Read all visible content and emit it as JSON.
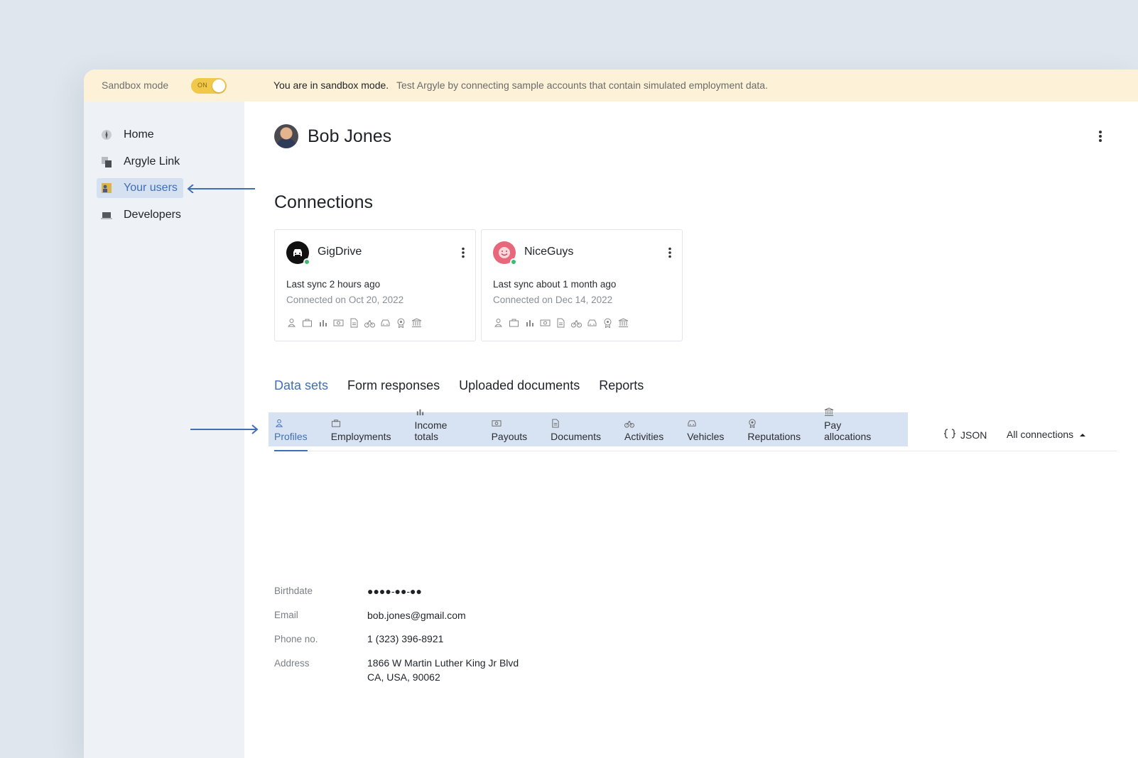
{
  "banner": {
    "sandbox_label": "Sandbox mode",
    "toggle_text": "ON",
    "strong_text": "You are in sandbox mode.",
    "text": "Test Argyle by connecting sample accounts that contain simulated employment data."
  },
  "sidebar": {
    "items": [
      {
        "label": "Home",
        "icon": "compass-icon"
      },
      {
        "label": "Argyle Link",
        "icon": "link-pages-icon"
      },
      {
        "label": "Your users",
        "icon": "users-icon",
        "active": true
      },
      {
        "label": "Developers",
        "icon": "laptop-icon"
      }
    ]
  },
  "user": {
    "name": "Bob Jones"
  },
  "connections": {
    "title": "Connections",
    "cards": [
      {
        "name": "GigDrive",
        "last_sync": "Last sync 2 hours ago",
        "connected": "Connected on Oct 20, 2022",
        "logo_color": "#111111",
        "logo_icon": "car-icon",
        "status_color": "#3dbb6f"
      },
      {
        "name": "NiceGuys",
        "last_sync": "Last sync about 1 month ago",
        "connected": "Connected on Dec 14, 2022",
        "logo_color": "#e8677a",
        "logo_icon": "smile-icon",
        "status_color": "#3dbb6f"
      }
    ]
  },
  "tabs": [
    {
      "label": "Data sets",
      "active": true
    },
    {
      "label": "Form responses"
    },
    {
      "label": "Uploaded documents"
    },
    {
      "label": "Reports"
    }
  ],
  "subtabs": [
    {
      "label": "Profiles",
      "icon": "person-icon",
      "active": true
    },
    {
      "label": "Employments",
      "icon": "briefcase-icon"
    },
    {
      "label": "Income totals",
      "icon": "bar-chart-icon"
    },
    {
      "label": "Payouts",
      "icon": "money-icon"
    },
    {
      "label": "Documents",
      "icon": "document-icon"
    },
    {
      "label": "Activities",
      "icon": "bicycle-icon"
    },
    {
      "label": "Vehicles",
      "icon": "car-icon"
    },
    {
      "label": "Reputations",
      "icon": "badge-icon"
    },
    {
      "label": "Pay allocations",
      "icon": "bank-icon"
    }
  ],
  "toolbar": {
    "json_label": "JSON",
    "connections_filter": "All connections"
  },
  "profile": {
    "birthdate_label": "Birthdate",
    "birthdate_value": "●●●●-●●-●●",
    "email_label": "Email",
    "email_value": "bob.jones@gmail.com",
    "phone_label": "Phone no.",
    "phone_value": "1 (323) 396-8921",
    "address_label": "Address",
    "address_line1": "1866 W Martin Luther King Jr Blvd",
    "address_line2": "CA, USA, 90062"
  },
  "colors": {
    "accent": "#3f6fb6",
    "banner": "#fdf1d7",
    "toggle": "#f2c84a",
    "subtab_bg": "#d7e2f3"
  }
}
